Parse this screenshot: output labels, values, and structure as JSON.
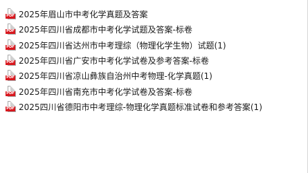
{
  "icon": {
    "name": "pdf-icon",
    "label": "PDF",
    "color": "#d8171e"
  },
  "files": [
    {
      "name": "2025年眉山市中考化学真题及答案"
    },
    {
      "name": "2025年四川省成都市中考化学试题及答案-标卷"
    },
    {
      "name": "2025年四川省达州市中考理综（物理化学生物）试题(1)"
    },
    {
      "name": "2025年四川省广安市中考化学试卷及参考答案-标卷"
    },
    {
      "name": "2025年四川省凉山彝族自治州中考物理-化学真题(1)"
    },
    {
      "name": "2025年四川省南充市中考化学试卷及答案-标卷"
    },
    {
      "name": "2025四川省德阳市中考理综-物理化学真题标准试卷和参考答案(1)"
    }
  ]
}
